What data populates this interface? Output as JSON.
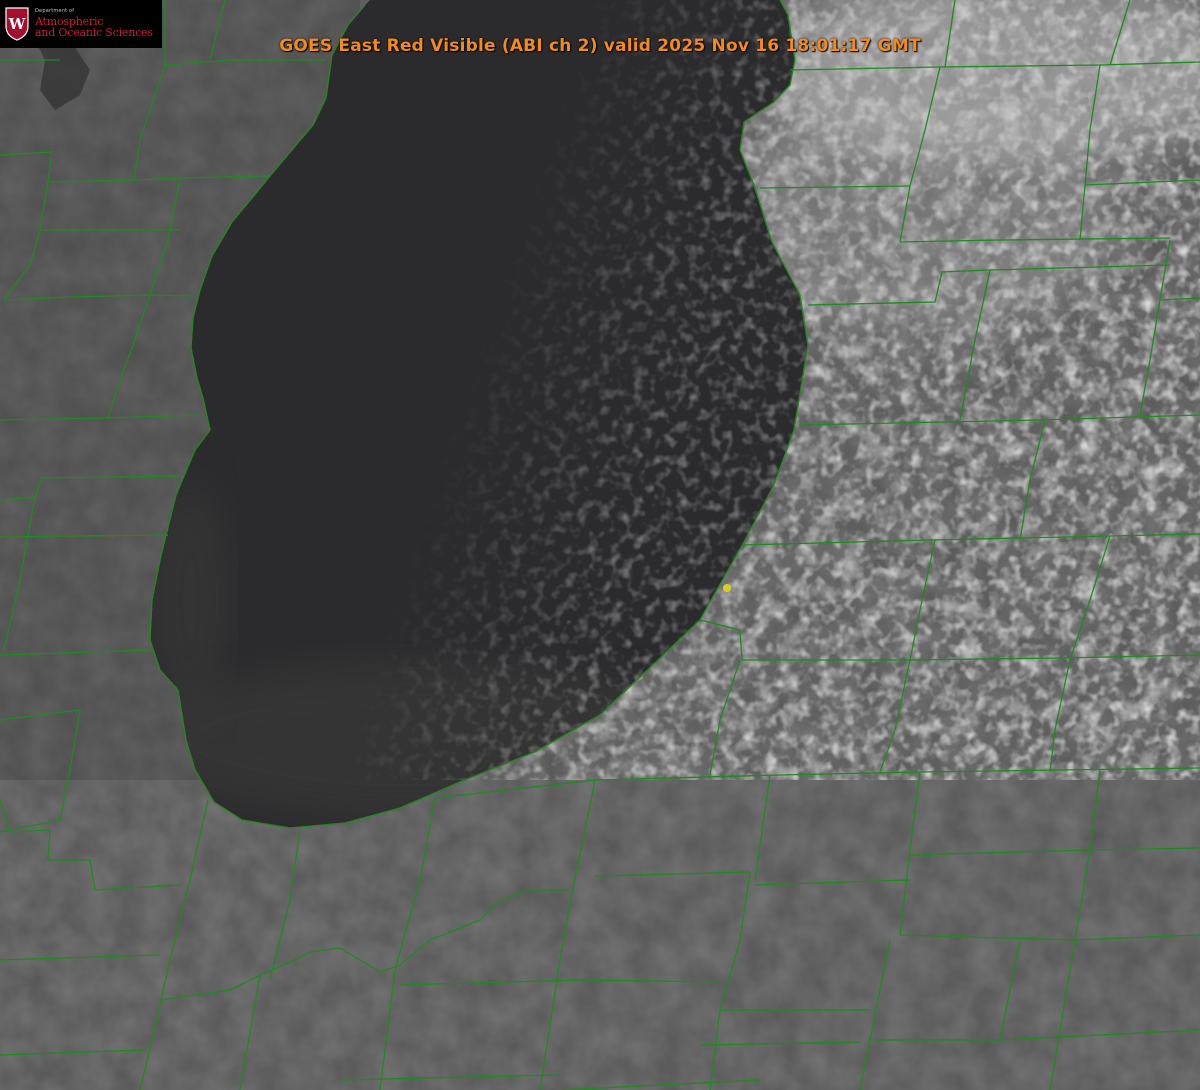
{
  "title": "GOES East Red Visible (ABI ch 2) valid 2025 Nov 16 18:01:17 GMT",
  "logo": {
    "department": "Department of",
    "line1": "Atmospheric",
    "line2": "and Oceanic Sciences",
    "crest_letter": "W"
  },
  "colors": {
    "title": "#f28a1e",
    "county_lines": "#1f8a1f",
    "state_border": "#c43c1e",
    "logo_text": "#c61e3c",
    "crest": "#a3102d",
    "marker": "#d8d020"
  },
  "marker": {
    "type": "location-dot",
    "color": "#d8d020"
  }
}
